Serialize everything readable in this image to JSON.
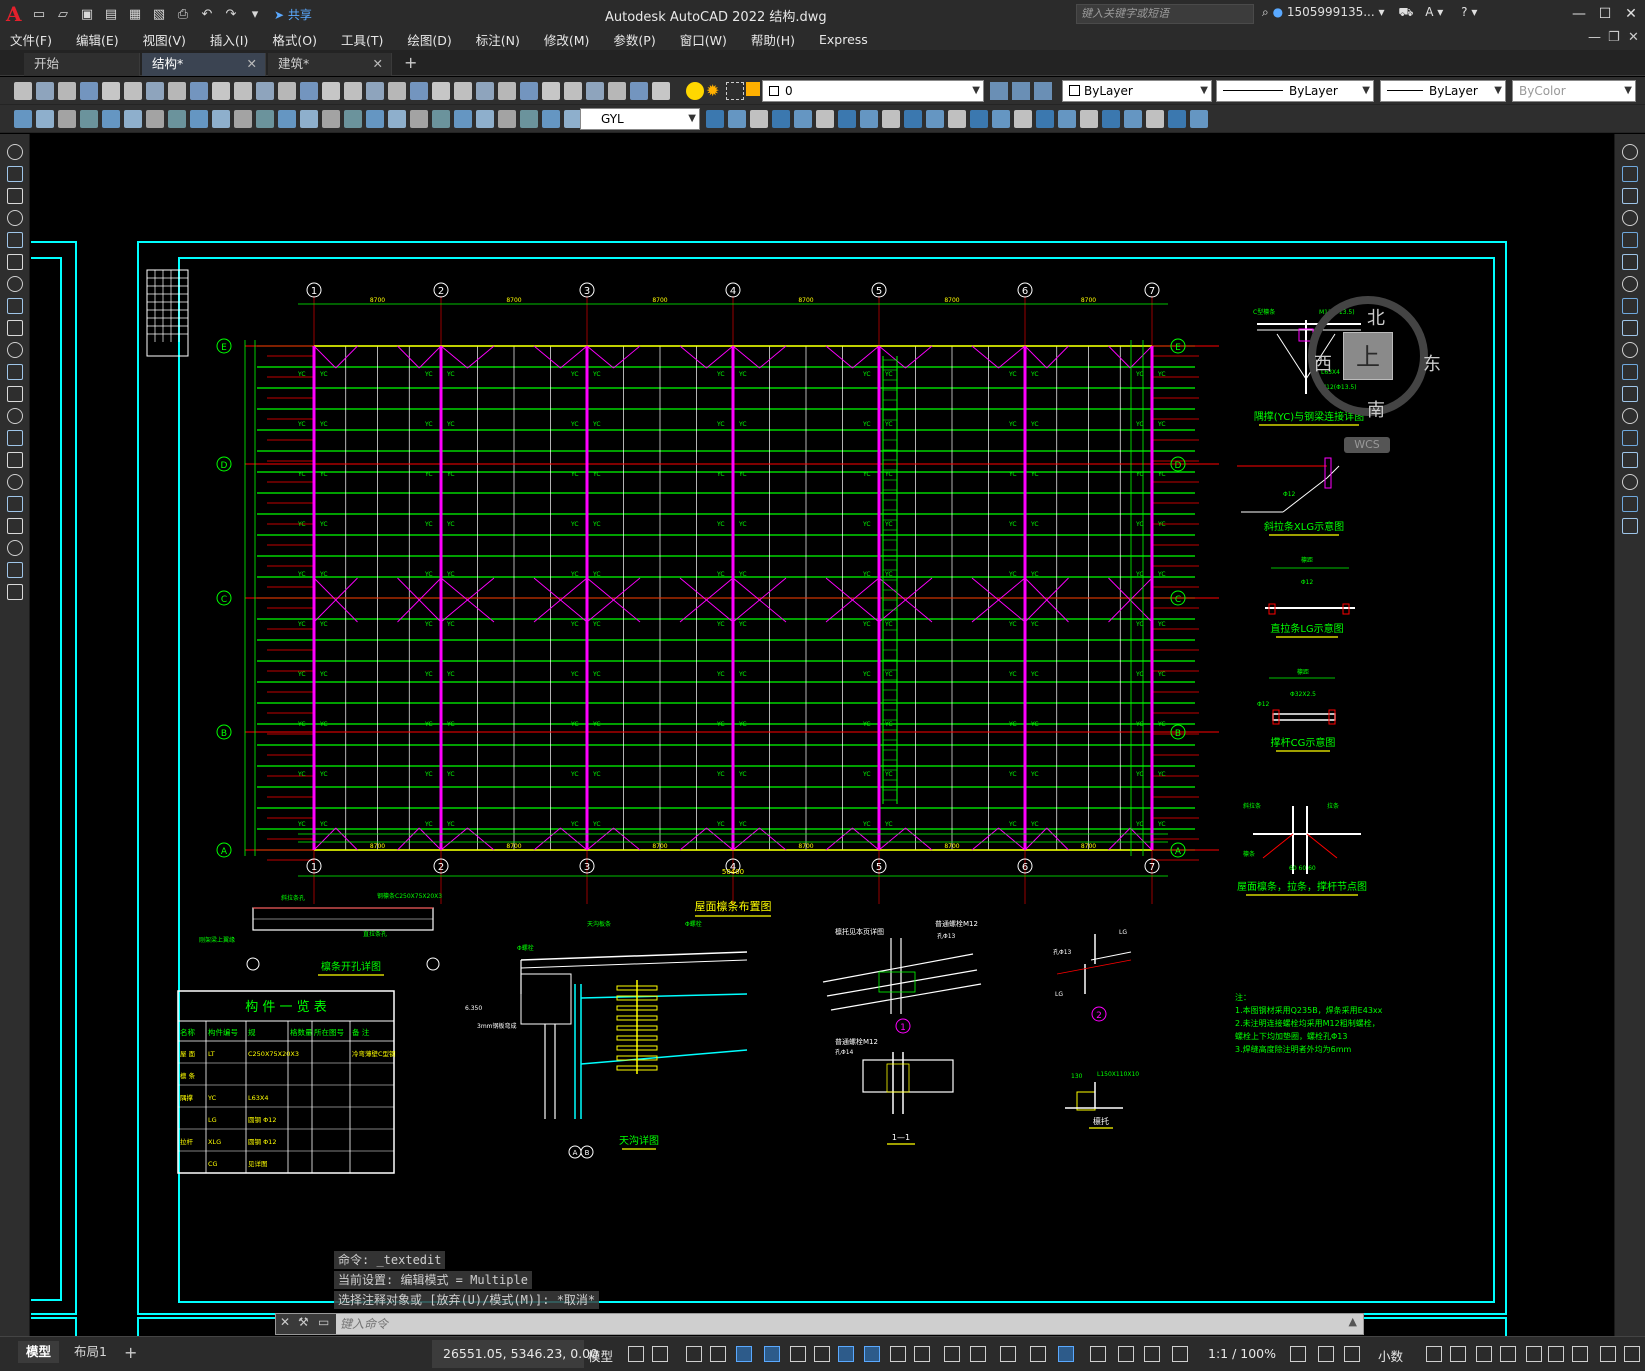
{
  "app": {
    "title": "Autodesk AutoCAD 2022    结构.dwg",
    "share_label": "共享",
    "search_placeholder": "键入关键字或短语",
    "user": "1505999135...",
    "logo": "A"
  },
  "menu": [
    "文件(F)",
    "编辑(E)",
    "视图(V)",
    "插入(I)",
    "格式(O)",
    "工具(T)",
    "绘图(D)",
    "标注(N)",
    "修改(M)",
    "参数(P)",
    "窗口(W)",
    "帮助(H)",
    "Express"
  ],
  "tabs": [
    {
      "label": "开始"
    },
    {
      "label": "结构*"
    },
    {
      "label": "建筑*"
    }
  ],
  "properties": {
    "layer": "0",
    "color": "ByLayer",
    "linetype": "ByLayer",
    "lineweight": "ByLayer",
    "plotstyle": "ByColor",
    "textstyle": "GYL"
  },
  "viewcube": {
    "north": "北",
    "south": "南",
    "east": "东",
    "west": "西",
    "top": "上",
    "wcs": "WCS"
  },
  "drawing": {
    "plan_title": "屋面檩条布置图",
    "axes_numbers": [
      "1",
      "2",
      "3",
      "4",
      "5",
      "6",
      "7"
    ],
    "axes_letters": [
      "E",
      "D",
      "C",
      "B",
      "A"
    ],
    "total_width": "50400",
    "bay_width": "8700",
    "details": [
      "隅撑(YC)与钢梁连接详图",
      "斜拉条XLG示意图",
      "直拉条LG示意图",
      "撑杆CG示意图",
      "屋面檩条，拉条，撑杆节点图",
      "檩条开孔详图",
      "天沟详图",
      "檩托"
    ],
    "purlin_note": "钢檩条C250X75X20X3",
    "gutter_note": "天沟板条",
    "bolt_note": "普通螺栓M12",
    "section_label": "1—1",
    "notes": [
      "注：",
      "1.本图钢材采用Q235B，焊条采用E43xx",
      "2.未注明连接螺栓均采用M12粗制螺栓，",
      "   螺栓上下均加垫圈，螺栓孔Φ13",
      "3.焊缝高度除注明者外均为6mm"
    ],
    "table": {
      "title": "构 件 一 览 表",
      "headers": [
        "名称",
        "构件编号",
        "规",
        "格数量",
        "所在图号",
        "备 注"
      ],
      "rows": [
        [
          "屋 面",
          "LT",
          "C250X75X20X3",
          "",
          "",
          "冷弯薄壁C型钢"
        ],
        [
          "檩 条",
          "",
          "",
          "",
          "",
          ""
        ],
        [
          "隅撑",
          "YC",
          "L63X4",
          "",
          "",
          ""
        ],
        [
          "",
          "LG",
          "圆钢 Φ12",
          "",
          "",
          ""
        ],
        [
          "拉杆",
          "XLG",
          "圆钢 Φ12",
          "",
          "",
          ""
        ],
        [
          "",
          "CG",
          "见详图",
          "",
          "",
          ""
        ]
      ]
    }
  },
  "command": {
    "history": [
      "命令: _textedit",
      "当前设置: 编辑模式 = Multiple",
      "选择注释对象或 [放弃(U)/模式(M)]: *取消*"
    ],
    "placeholder": "键入命令"
  },
  "status": {
    "layout_tabs": [
      "模型",
      "布局1"
    ],
    "coords": "26551.05, 5346.23, 0.00",
    "model_label": "模型",
    "scale": "1:1 / 100%",
    "units": "小数"
  },
  "colors": {
    "bg": "#000000",
    "cyan": "#00ffff",
    "green": "#00ff00",
    "red": "#ff0000",
    "magenta": "#ff00ff",
    "yellow": "#ffff00",
    "white": "#ffffff"
  }
}
